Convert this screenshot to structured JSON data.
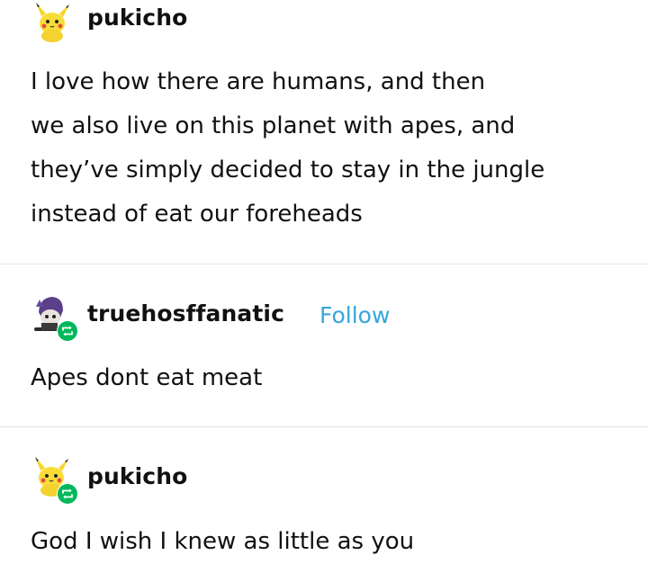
{
  "posts": [
    {
      "username": "pukicho",
      "avatar_icon": "pikachu-avatar-icon",
      "reblog": false,
      "body_lines": [
        "I love how there are humans, and then",
        "we also live on this planet with apes, and",
        "they’ve simply decided to stay in the jungle",
        "instead of eat our foreheads"
      ]
    },
    {
      "username": "truehosffanatic",
      "follow_label": "Follow",
      "avatar_icon": "character-avatar-icon",
      "reblog": true,
      "body_lines": [
        "Apes dont eat meat"
      ]
    },
    {
      "username": "pukicho",
      "avatar_icon": "pikachu-avatar-icon",
      "reblog": true,
      "body_lines": [
        "God I wish I knew as little as you"
      ]
    }
  ],
  "colors": {
    "follow_link": "#35a6dd",
    "reblog_badge": "#00b85c",
    "divider": "#e6e6e6"
  }
}
